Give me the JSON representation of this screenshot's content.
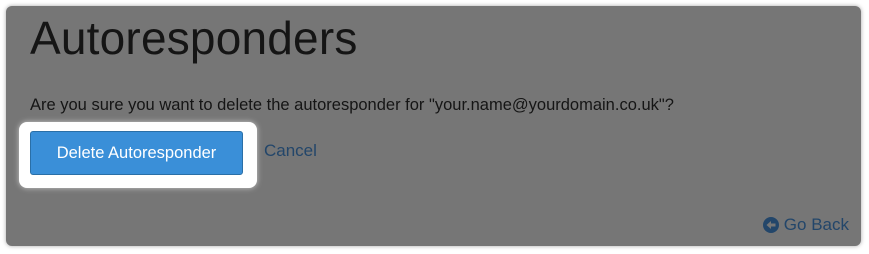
{
  "page": {
    "title": "Autoresponders",
    "confirm_text": "Are you sure you want to delete the autoresponder for \"your.name@yourdomain.co.uk\"?"
  },
  "actions": {
    "delete_label": "Delete Autoresponder",
    "cancel_label": "Cancel",
    "go_back_label": "Go Back"
  },
  "icons": {
    "go_back": "arrow-circle-left-icon"
  },
  "colors": {
    "overlay": "#767676",
    "primary_button": "#3a8fd8",
    "link": "#23466a",
    "highlight": "#ffffff"
  }
}
